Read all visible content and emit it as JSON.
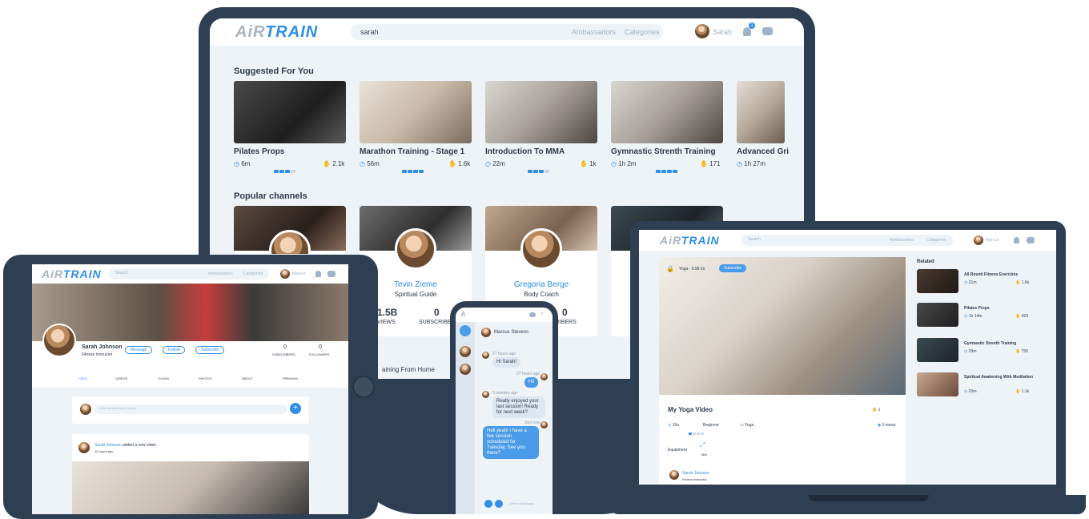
{
  "desktop": {
    "logo": {
      "a": "AiR",
      "t": "TRAIN"
    },
    "search_value": "sarah",
    "nav": [
      "Ambassadors",
      "Categories"
    ],
    "user": "Sarah",
    "notification_count": "1",
    "suggested_title": "Suggested For You",
    "suggested": [
      {
        "title": "Pilates Props",
        "duration": "6m",
        "likes": "2.1k",
        "level": 3
      },
      {
        "title": "Marathon Training - Stage 1",
        "duration": "56m",
        "likes": "1.6k",
        "level": 4
      },
      {
        "title": "Introduction To MMA",
        "duration": "22m",
        "likes": "1k",
        "level": 3
      },
      {
        "title": "Gymnastic Strenth Training",
        "duration": "1h 2m",
        "likes": "171",
        "level": 4
      },
      {
        "title": "Advanced Gri",
        "duration": "1h 27m",
        "likes": "",
        "level": 0
      }
    ],
    "channels_title": "Popular channels",
    "channels": [
      {
        "name": "",
        "role": ""
      },
      {
        "name": "Tevin Zieme",
        "role": "Spiritual Guide",
        "views": "1.5B",
        "views_label": "EO VIEWS",
        "subs": "0",
        "subs_label": "SUBSCRIBE"
      },
      {
        "name": "Gregoria Berge",
        "role": "Body Coach",
        "views": "",
        "views_label": "",
        "subs": "0",
        "subs_label": "SCRIBERS"
      }
    ],
    "below_text": "aining From Home"
  },
  "tablet": {
    "search_placeholder": "Search",
    "nav": [
      "Ambassadors",
      "Categories"
    ],
    "user": "Marcus",
    "profile_name": "Sarah Johnson",
    "profile_role": "Fitness Instructor",
    "buttons": [
      "Message",
      "Follow",
      "Subscribe"
    ],
    "subscribers": "0",
    "subscribers_label": "SUBSCRIBERS",
    "followers": "0",
    "followers_label": "FOLLOWERS",
    "tabs": [
      "FEED",
      "VIDEOS",
      "PLANS",
      "PHOTOS",
      "ABOUT",
      "PREMIUM"
    ],
    "post_placeholder": "Write something to Sarah...",
    "activity_name": "Sarah Johnson",
    "activity_text": "added a new video",
    "activity_time": "15 hours ago"
  },
  "phone": {
    "contact": "Marcus Stevens",
    "messages": [
      {
        "dir": "in",
        "time": "27 hours ago",
        "text": "Hi Sarah!"
      },
      {
        "dir": "out",
        "time": "27 hours ago",
        "text": "Hi!"
      },
      {
        "dir": "in",
        "time": "5 minutes ago",
        "text": "Really enjoyed your last session! Ready for next week?"
      },
      {
        "dir": "out",
        "time": "Just now",
        "text": "Hell yeah! I have a live session scheduled for Tuesday. See you there?"
      }
    ],
    "input_placeholder": "Write a message..."
  },
  "laptop": {
    "search_placeholder": "Search",
    "nav": [
      "Ambassadors",
      "Categories"
    ],
    "user": "Marcus",
    "plan_label": "Yoga - 9.99 /m",
    "subscribe_label": "Subscribe",
    "video_title": "My Yoga Video",
    "duration": "15s",
    "level_text": "Beginner",
    "category": "Yoga",
    "views": "0 views",
    "likes": "1",
    "equipment_label": "Equipment",
    "equipment_item": "Mat",
    "author_name": "Sarah Johnson",
    "author_role": "Fitness Instructor",
    "related_title": "Related",
    "related": [
      {
        "title": "All Round Fitness Exercises",
        "duration": "21m",
        "likes": "1.6k"
      },
      {
        "title": "Pilates Props",
        "duration": "1h 14m",
        "likes": "423"
      },
      {
        "title": "Gymnastic Strenth Training",
        "duration": "29m",
        "likes": "750"
      },
      {
        "title": "Spiritual Awakening With Meditation",
        "duration": "20m",
        "likes": "1.1k"
      }
    ]
  },
  "colors": {
    "frame": "#2f3f53",
    "accent": "#2e8ee8",
    "background": "#eef3f8"
  }
}
